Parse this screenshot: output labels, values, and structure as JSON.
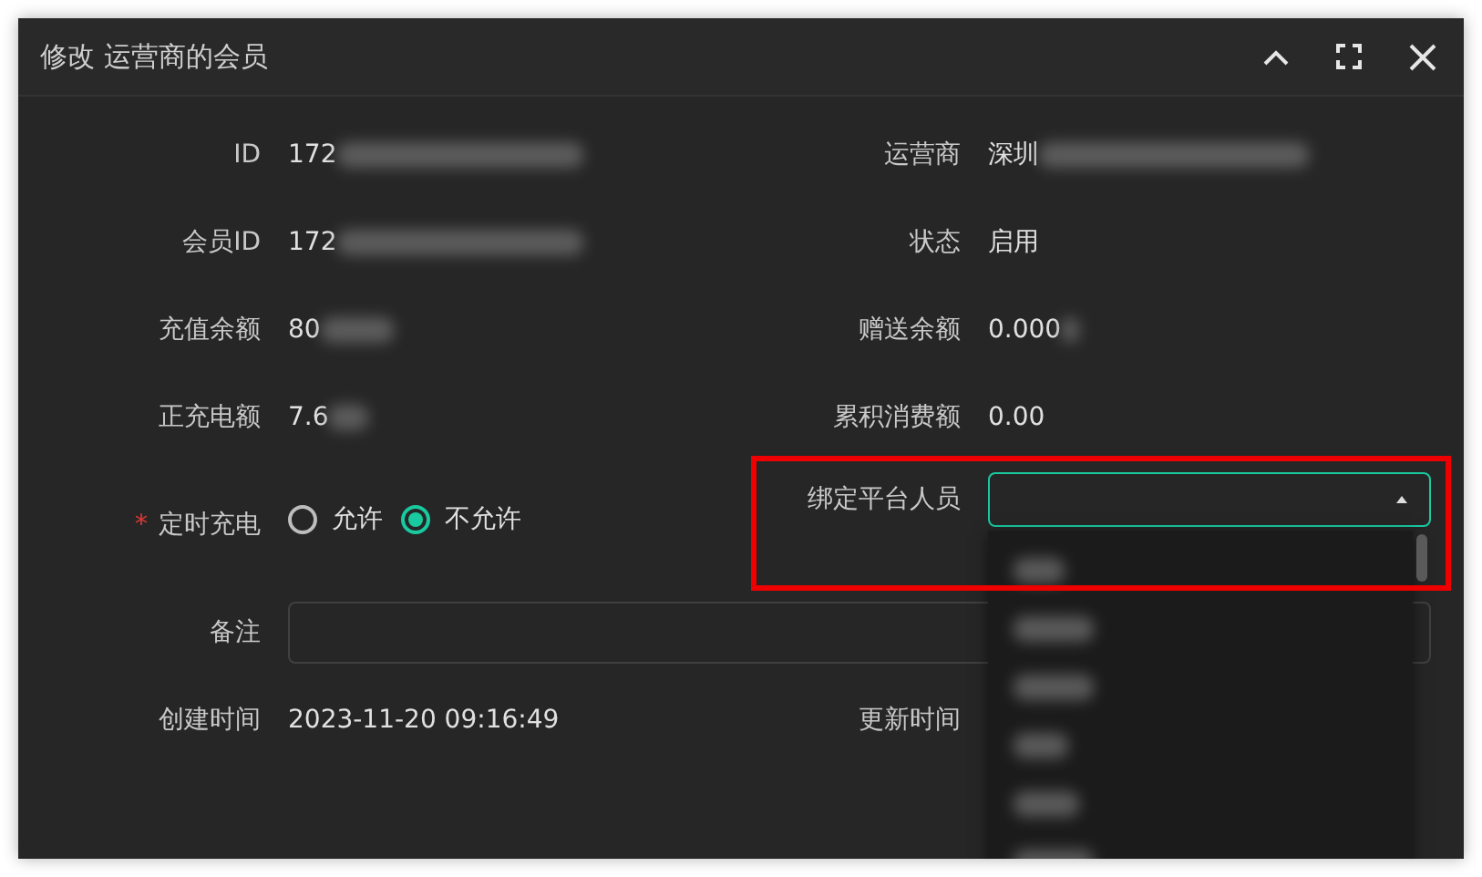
{
  "dialog": {
    "title": "修改 运营商的会员"
  },
  "info_rows": [
    {
      "left": {
        "label": "ID",
        "value": "172",
        "redacted": true
      },
      "right": {
        "label": "运营商",
        "value": "深圳",
        "redacted": true
      }
    },
    {
      "left": {
        "label": "会员ID",
        "value": "172",
        "redacted": true
      },
      "right": {
        "label": "状态",
        "value": "启用",
        "redacted": false
      }
    },
    {
      "left": {
        "label": "充值余额",
        "value": "80",
        "redacted": true
      },
      "right": {
        "label": "赠送余额",
        "value": "0.000",
        "redacted": true
      }
    },
    {
      "left": {
        "label": "正充电额",
        "value": "7.6",
        "redacted": true
      },
      "right": {
        "label": "累积消费额",
        "value": "0.00",
        "redacted": false
      }
    }
  ],
  "schedule": {
    "label": "定时充电",
    "required_mark": "*",
    "options": [
      {
        "label": "允许",
        "selected": false
      },
      {
        "label": "不允许",
        "selected": true
      }
    ]
  },
  "binding": {
    "label": "绑定平台人员",
    "expanded": true,
    "highlighted": true,
    "options": [
      {
        "kind": "redacted"
      },
      {
        "kind": "redacted"
      },
      {
        "kind": "redacted"
      },
      {
        "kind": "redacted"
      },
      {
        "kind": "redacted"
      },
      {
        "kind": "redacted"
      }
    ]
  },
  "remark": {
    "label": "备注"
  },
  "created": {
    "label": "创建时间",
    "value": "2023-11-20 09:16:49"
  },
  "updated": {
    "label": "更新时间"
  }
}
